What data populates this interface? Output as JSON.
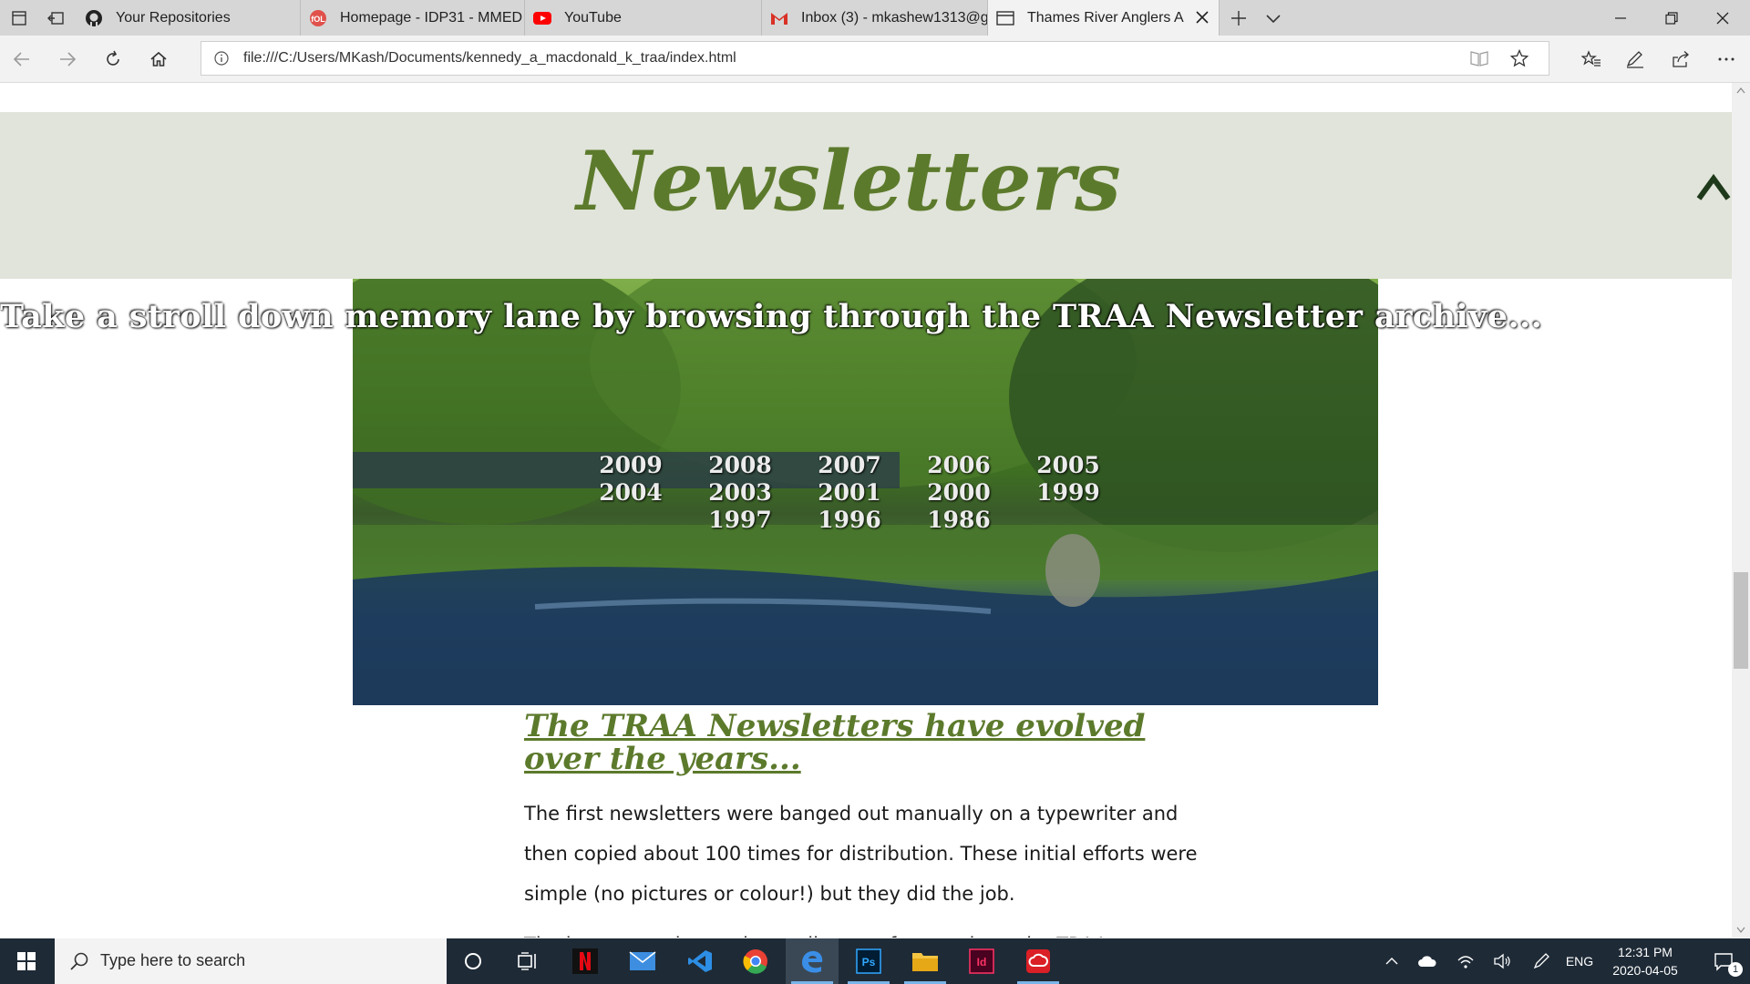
{
  "browser": {
    "tabs": [
      {
        "title": "Your Repositories",
        "icon": "github-icon"
      },
      {
        "title": "Homepage - IDP31 - MMED",
        "icon": "fol-icon"
      },
      {
        "title": "YouTube",
        "icon": "youtube-icon"
      },
      {
        "title": "Inbox (3) - mkashew1313@g",
        "icon": "gmail-icon"
      },
      {
        "title": "Thames River Anglers A",
        "icon": "page-icon",
        "active": true
      }
    ],
    "url": "file:///C:/Users/MKash/Documents/kennedy_a_macdonald_k_traa/index.html"
  },
  "page": {
    "title": "Newsletters",
    "tagline": "Take a stroll down memory lane by browsing through the TRAA Newsletter archive...",
    "years": {
      "row1": [
        "2009",
        "2008",
        "2007",
        "2006",
        "2005"
      ],
      "row2": [
        "2004",
        "2003",
        "2001",
        "2000",
        "1999"
      ],
      "row3": [
        "1997",
        "1996",
        "1986"
      ]
    },
    "section_heading": "The TRAA Newsletters have evolved over the years...",
    "paragraph1": "The first newsletters were banged out manually on a typewriter and then copied about 100 times for distribution. These initial efforts were simple (no pictures or colour!) but they did the job.",
    "paragraph2_partial": "The latest newsletters have all sorts of news about the TRAA..."
  },
  "taskbar": {
    "search_placeholder": "Type here to search",
    "apps": [
      "cortana-icon",
      "task-view-icon",
      "netflix-icon",
      "mail-icon",
      "vscode-icon",
      "chrome-icon",
      "edge-icon",
      "photoshop-icon",
      "file-explorer-icon",
      "indesign-icon",
      "creative-cloud-icon"
    ],
    "language": "ENG",
    "time": "12:31 PM",
    "date": "2020-04-05",
    "notification_count": "1"
  },
  "colors": {
    "accent_green": "#5c7a2c",
    "banner_bg": "#e1e4da",
    "taskbar_bg": "#1e2a36"
  }
}
